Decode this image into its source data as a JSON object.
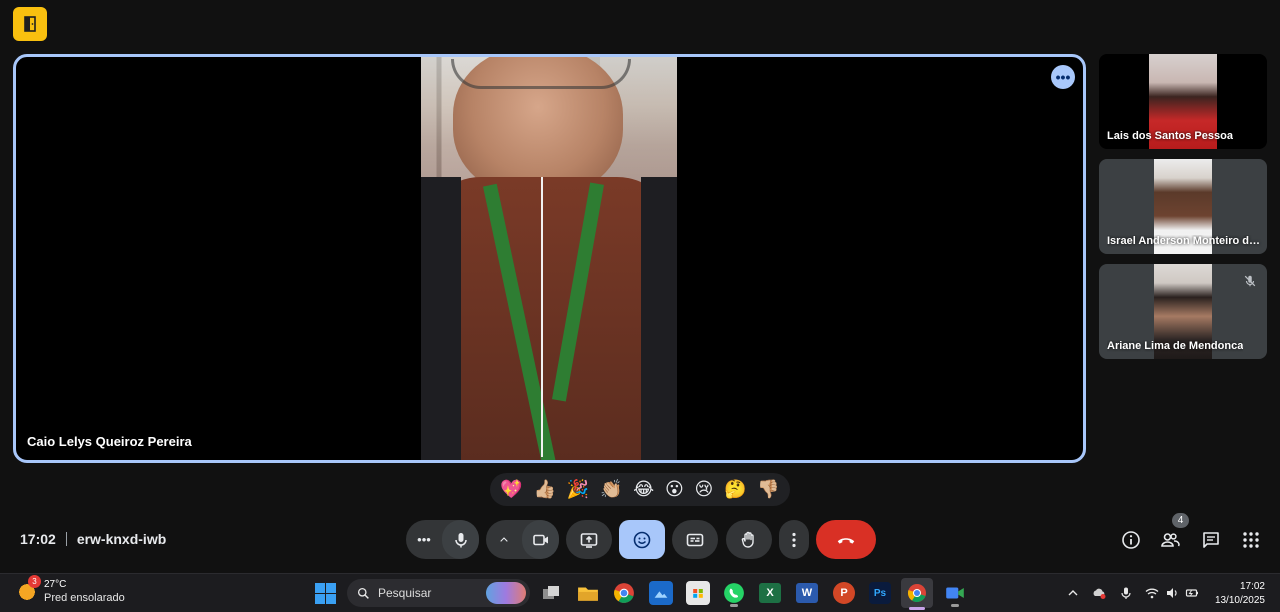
{
  "meeting": {
    "time": "17:02",
    "code": "erw-knxd-iwb"
  },
  "main_tile": {
    "participant": "Caio Lelys Queiroz Pereira"
  },
  "side_tiles": [
    {
      "name": "Lais dos Santos Pessoa",
      "muted": false
    },
    {
      "name": "Israel Anderson Monteiro da...",
      "muted": false
    },
    {
      "name": "Ariane Lima de Mendonca",
      "muted": true
    }
  ],
  "reactions": [
    "💖",
    "👍🏼",
    "🎉",
    "👏🏼",
    "😂",
    "😮",
    "😢",
    "🤔",
    "👎🏼"
  ],
  "controls": {
    "active_button": "emoji",
    "end_call_color": "#d93025",
    "accent_color": "#a8c7fa"
  },
  "people_count": "4",
  "taskbar": {
    "weather_badge": "3",
    "temperature": "27°C",
    "weather_desc": "Pred ensolarado",
    "search_placeholder": "Pesquisar",
    "apps": [
      {
        "name": "Excel",
        "glyph": "X",
        "color": "#1d7044"
      },
      {
        "name": "Word",
        "glyph": "W",
        "color": "#2b5aad"
      },
      {
        "name": "PowerPoint",
        "glyph": "P",
        "color": "#d24726"
      },
      {
        "name": "Photoshop",
        "glyph": "Ps",
        "color": "#0a1b3d"
      }
    ],
    "clock_time": "17:02",
    "clock_date": "13/10/2025"
  }
}
